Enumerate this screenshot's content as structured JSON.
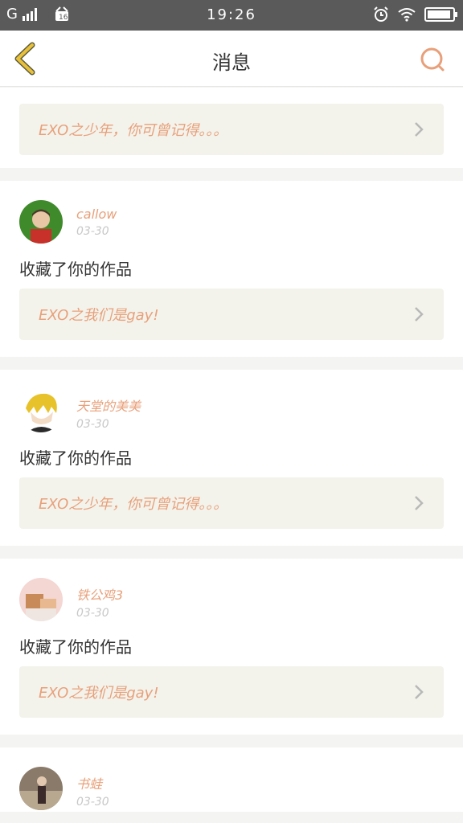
{
  "status": {
    "carrier": "G",
    "time": "19:26"
  },
  "nav": {
    "title": "消息"
  },
  "partial_item": {
    "work_title": "EXO之少年，你可曾记得。。。"
  },
  "items": [
    {
      "username": "callow",
      "date": "03-30",
      "action": "收藏了你的作品",
      "work_title": "EXO之我们是gay!"
    },
    {
      "username": "天堂的美美",
      "date": "03-30",
      "action": "收藏了你的作品",
      "work_title": "EXO之少年，你可曾记得。。。"
    },
    {
      "username": "铁公鸡3",
      "date": "03-30",
      "action": "收藏了你的作品",
      "work_title": "EXO之我们是gay!"
    },
    {
      "username": "书蛙",
      "date": "03-30"
    }
  ],
  "colors": {
    "accent": "#e8a07a",
    "back_icon": "#e8c03a",
    "card_link_bg": "#f3f3ec"
  }
}
